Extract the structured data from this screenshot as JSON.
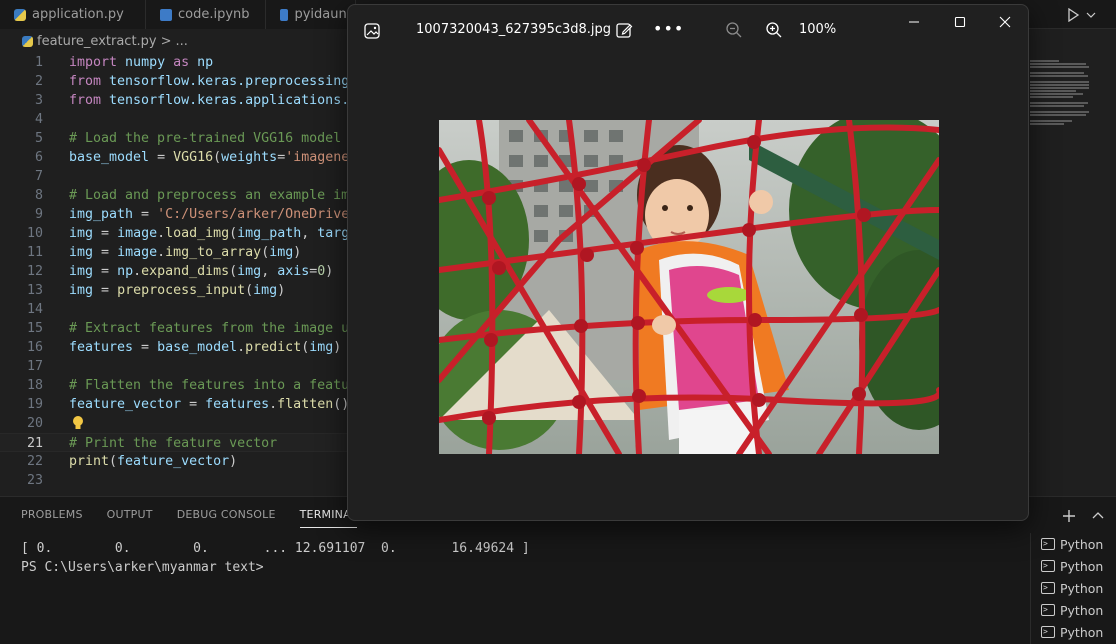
{
  "tabs": [
    {
      "label": "application.py",
      "icon": "python-file-icon"
    },
    {
      "label": "code.ipynb",
      "icon": "notebook-file-icon"
    },
    {
      "label": "pyidaung",
      "icon": "python-file-icon"
    }
  ],
  "breadcrumb": {
    "file": "feature_extract.py",
    "sep": ">",
    "rest": "..."
  },
  "editor": {
    "active_line": 21,
    "lines": [
      {
        "n": "1",
        "tokens": [
          {
            "t": "import",
            "c": "kw"
          },
          {
            "t": " numpy ",
            "c": "id"
          },
          {
            "t": "as",
            "c": "kw"
          },
          {
            "t": " np",
            "c": "id"
          }
        ]
      },
      {
        "n": "2",
        "tokens": [
          {
            "t": "from",
            "c": "kw"
          },
          {
            "t": " tensorflow.keras.preprocessing",
            "c": "id"
          }
        ]
      },
      {
        "n": "3",
        "tokens": [
          {
            "t": "from",
            "c": "kw"
          },
          {
            "t": " tensorflow.keras.applications.vg",
            "c": "id"
          }
        ]
      },
      {
        "n": "4",
        "tokens": []
      },
      {
        "n": "5",
        "tokens": [
          {
            "t": "# Load the pre-trained VGG16 model",
            "c": "cm"
          }
        ]
      },
      {
        "n": "6",
        "tokens": [
          {
            "t": "base_model",
            "c": "id"
          },
          {
            "t": " = ",
            "c": ""
          },
          {
            "t": "VGG16",
            "c": "fn"
          },
          {
            "t": "(",
            "c": ""
          },
          {
            "t": "weights",
            "c": "pr"
          },
          {
            "t": "=",
            "c": ""
          },
          {
            "t": "'imagenet",
            "c": "str"
          }
        ]
      },
      {
        "n": "7",
        "tokens": []
      },
      {
        "n": "8",
        "tokens": [
          {
            "t": "# Load and preprocess an example imag",
            "c": "cm"
          }
        ]
      },
      {
        "n": "9",
        "tokens": [
          {
            "t": "img_path",
            "c": "id"
          },
          {
            "t": " = ",
            "c": ""
          },
          {
            "t": "'C:/Users/arker/OneDrive/D",
            "c": "str"
          }
        ]
      },
      {
        "n": "10",
        "tokens": [
          {
            "t": "img",
            "c": "id"
          },
          {
            "t": " = ",
            "c": ""
          },
          {
            "t": "image",
            "c": "id"
          },
          {
            "t": ".",
            "c": ""
          },
          {
            "t": "load_img",
            "c": "fn"
          },
          {
            "t": "(",
            "c": ""
          },
          {
            "t": "img_path",
            "c": "id"
          },
          {
            "t": ", ",
            "c": ""
          },
          {
            "t": "target",
            "c": "pr"
          }
        ]
      },
      {
        "n": "11",
        "tokens": [
          {
            "t": "img",
            "c": "id"
          },
          {
            "t": " = ",
            "c": ""
          },
          {
            "t": "image",
            "c": "id"
          },
          {
            "t": ".",
            "c": ""
          },
          {
            "t": "img_to_array",
            "c": "fn"
          },
          {
            "t": "(",
            "c": ""
          },
          {
            "t": "img",
            "c": "id"
          },
          {
            "t": ")",
            "c": ""
          }
        ]
      },
      {
        "n": "12",
        "tokens": [
          {
            "t": "img",
            "c": "id"
          },
          {
            "t": " = ",
            "c": ""
          },
          {
            "t": "np",
            "c": "id"
          },
          {
            "t": ".",
            "c": ""
          },
          {
            "t": "expand_dims",
            "c": "fn"
          },
          {
            "t": "(",
            "c": ""
          },
          {
            "t": "img",
            "c": "id"
          },
          {
            "t": ", ",
            "c": ""
          },
          {
            "t": "axis",
            "c": "pr"
          },
          {
            "t": "=",
            "c": ""
          },
          {
            "t": "0",
            "c": "num"
          },
          {
            "t": ")",
            "c": ""
          }
        ]
      },
      {
        "n": "13",
        "tokens": [
          {
            "t": "img",
            "c": "id"
          },
          {
            "t": " = ",
            "c": ""
          },
          {
            "t": "preprocess_input",
            "c": "fn"
          },
          {
            "t": "(",
            "c": ""
          },
          {
            "t": "img",
            "c": "id"
          },
          {
            "t": ")",
            "c": ""
          }
        ]
      },
      {
        "n": "14",
        "tokens": []
      },
      {
        "n": "15",
        "tokens": [
          {
            "t": "# Extract features from the image us",
            "c": "cm"
          }
        ]
      },
      {
        "n": "16",
        "tokens": [
          {
            "t": "features",
            "c": "id"
          },
          {
            "t": " = ",
            "c": ""
          },
          {
            "t": "base_model",
            "c": "id"
          },
          {
            "t": ".",
            "c": ""
          },
          {
            "t": "predict",
            "c": "fn"
          },
          {
            "t": "(",
            "c": ""
          },
          {
            "t": "img",
            "c": "id"
          },
          {
            "t": ")",
            "c": ""
          }
        ]
      },
      {
        "n": "17",
        "tokens": []
      },
      {
        "n": "18",
        "tokens": [
          {
            "t": "# Flatten the features into a feature",
            "c": "cm"
          }
        ]
      },
      {
        "n": "19",
        "tokens": [
          {
            "t": "feature_vector",
            "c": "id"
          },
          {
            "t": " = ",
            "c": ""
          },
          {
            "t": "features",
            "c": "id"
          },
          {
            "t": ".",
            "c": ""
          },
          {
            "t": "flatten",
            "c": "fn"
          },
          {
            "t": "()",
            "c": ""
          }
        ]
      },
      {
        "n": "20",
        "tokens": []
      },
      {
        "n": "21",
        "tokens": [
          {
            "t": "# Print the feature vector",
            "c": "cm"
          }
        ]
      },
      {
        "n": "22",
        "tokens": [
          {
            "t": "print",
            "c": "fn"
          },
          {
            "t": "(",
            "c": ""
          },
          {
            "t": "feature_vector",
            "c": "id"
          },
          {
            "t": ")",
            "c": ""
          }
        ]
      },
      {
        "n": "23",
        "tokens": []
      }
    ]
  },
  "panel": {
    "tabs": [
      "PROBLEMS",
      "OUTPUT",
      "DEBUG CONSOLE",
      "TERMINAL"
    ],
    "active_tab": "TERMINAL",
    "terminal_lines": [
      "[ 0.        0.        0.       ... 12.691107  0.       16.49624 ]",
      "PS C:\\Users\\arker\\myanmar text>"
    ],
    "terminals": [
      "Python",
      "Python",
      "Python",
      "Python",
      "Python"
    ]
  },
  "viewer": {
    "file_name": "1007320043_627395c3d8.jpg",
    "more_label": "•••",
    "zoom": "100%"
  },
  "colors": {
    "editor_bg": "#1f1f1f",
    "keyword": "#c586c0",
    "function": "#dcdcaa",
    "comment": "#6a9955",
    "string": "#ce9178",
    "variable": "#9cdcfe"
  }
}
